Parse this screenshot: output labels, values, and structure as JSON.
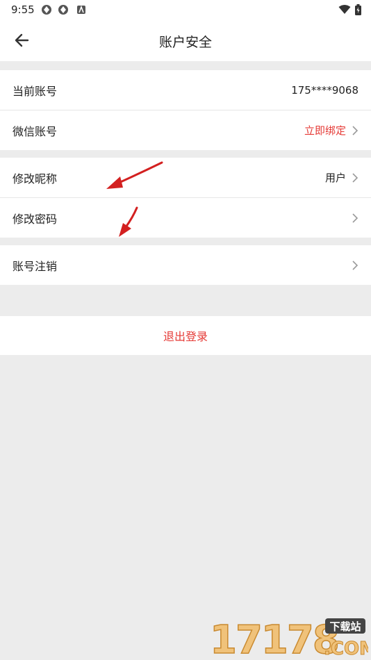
{
  "status_bar": {
    "time": "9:55"
  },
  "header": {
    "title": "账户安全"
  },
  "rows": {
    "account": {
      "label": "当前账号",
      "value": "175****9068"
    },
    "wechat": {
      "label": "微信账号",
      "value": "立即绑定"
    },
    "nickname": {
      "label": "修改昵称",
      "value": "用户"
    },
    "password": {
      "label": "修改密码"
    },
    "cancel": {
      "label": "账号注销"
    }
  },
  "logout": {
    "label": "退出登录"
  },
  "colors": {
    "accent": "#e53935",
    "background": "#ececec",
    "annotation_arrow": "#d32020"
  },
  "icons": [
    "back-arrow-icon",
    "chevron-right-icon",
    "wifi-icon",
    "battery-icon"
  ],
  "watermark": {
    "text": "17178",
    "suffix": "下载站",
    "domain": ".COM"
  }
}
